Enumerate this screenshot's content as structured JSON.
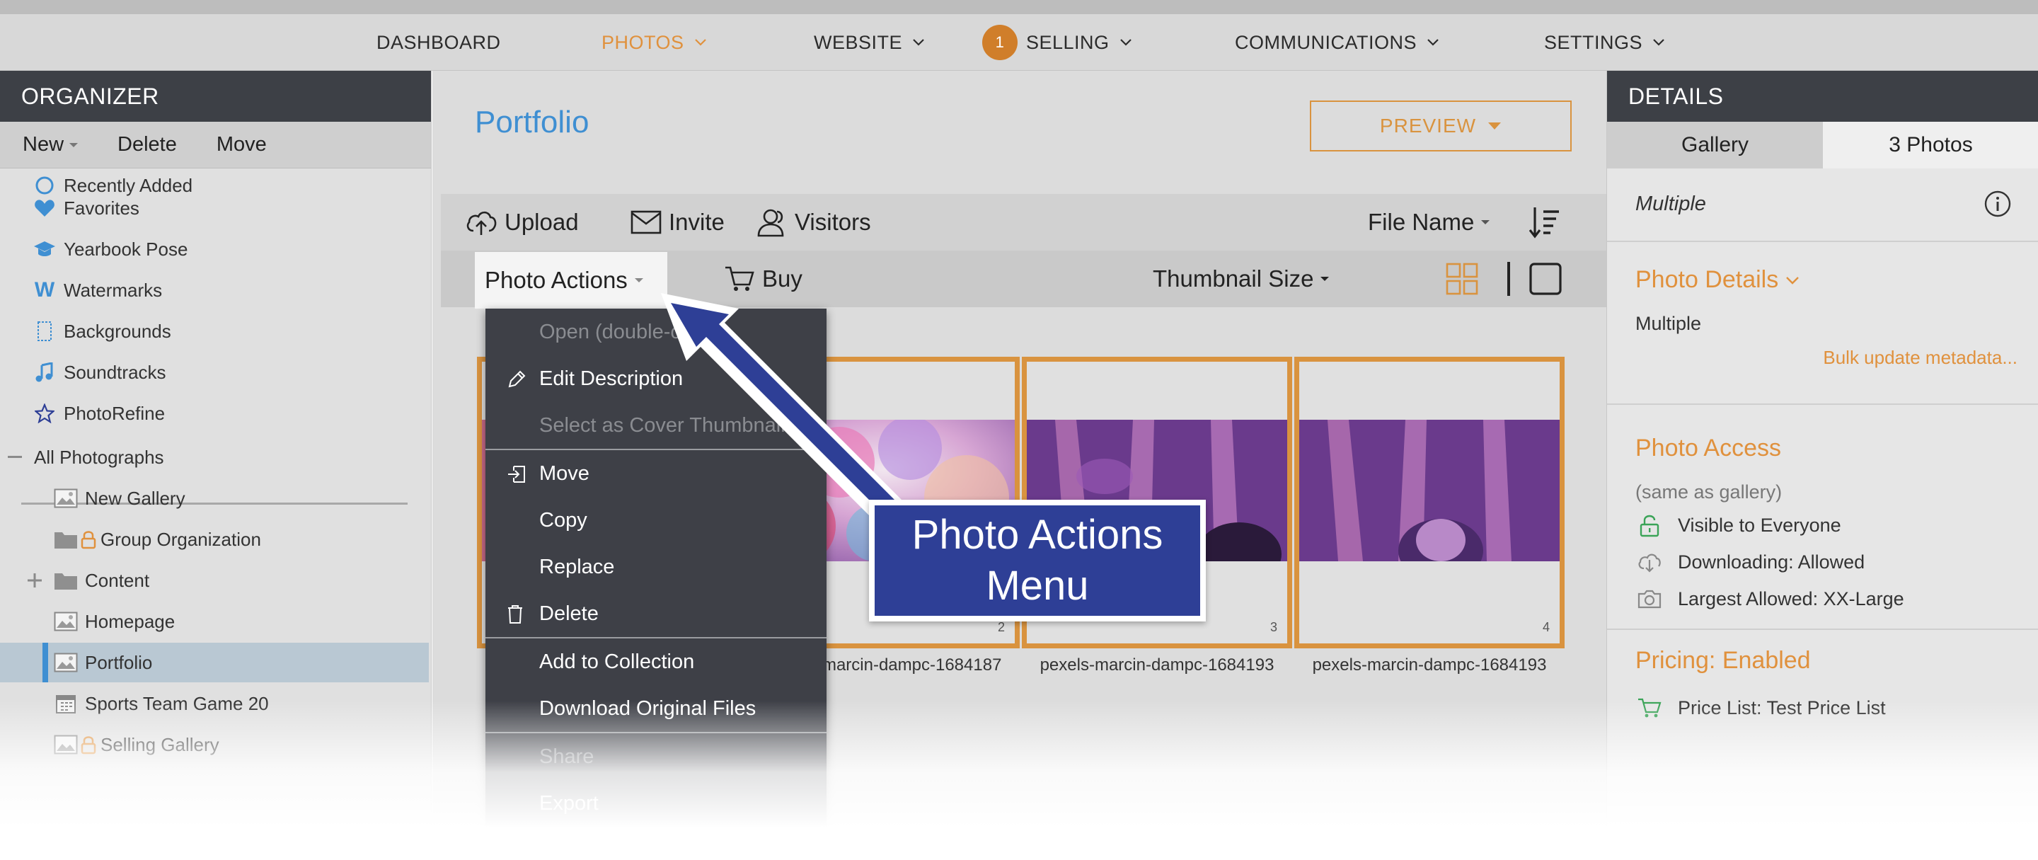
{
  "nav": {
    "items": [
      {
        "label": "DASHBOARD"
      },
      {
        "label": "PHOTOS"
      },
      {
        "label": "WEBSITE"
      },
      {
        "label": "SELLING",
        "badge": "1"
      },
      {
        "label": "COMMUNICATIONS"
      },
      {
        "label": "SETTINGS"
      }
    ]
  },
  "organizer": {
    "title": "ORGANIZER",
    "toolbar": {
      "new": "New",
      "delete": "Delete",
      "move": "Move"
    },
    "items": [
      {
        "label": "Recently Added",
        "icon": "clock-icon"
      },
      {
        "label": "Favorites",
        "icon": "heart-icon"
      },
      {
        "label": "Yearbook Pose",
        "icon": "graduation-cap-icon"
      },
      {
        "label": "Watermarks",
        "icon": "watermark-w-icon"
      },
      {
        "label": "Backgrounds",
        "icon": "backgrounds-icon"
      },
      {
        "label": "Soundtracks",
        "icon": "music-note-icon"
      },
      {
        "label": "PhotoRefine",
        "icon": "star-outline-icon"
      },
      {
        "label": "All Photographs",
        "icon": "collapse-minus-icon"
      },
      {
        "label": "New Gallery",
        "icon": "gallery-icon"
      },
      {
        "label": "Group Organization",
        "icon": "folder-locked-icon"
      },
      {
        "label": "Content",
        "icon": "folder-icon"
      },
      {
        "label": "Homepage",
        "icon": "gallery-icon"
      },
      {
        "label": "Portfolio",
        "icon": "gallery-icon"
      },
      {
        "label": "Sports Team Game 20",
        "icon": "calendar-icon"
      },
      {
        "label": "Selling Gallery",
        "icon": "gallery-locked-icon"
      }
    ]
  },
  "main": {
    "title": "Portfolio",
    "preview_label": "PREVIEW",
    "toolbar": {
      "upload": "Upload",
      "invite": "Invite",
      "visitors": "Visitors",
      "sort": "File Name",
      "photo_actions": "Photo Actions",
      "buy": "Buy",
      "thumbnail_size": "Thumbnail Size"
    },
    "photos": [
      {
        "name": "pexels-marcin-dampc-1684187",
        "index": "2"
      },
      {
        "name": "pexels-marcin-dampc-1684193",
        "index": "3"
      },
      {
        "name": "pexels-marcin-dampc-1684193",
        "index": "4"
      }
    ]
  },
  "menu": {
    "items": [
      {
        "label": "Open (double-click)",
        "disabled": true
      },
      {
        "label": "Edit Description",
        "icon": "pencil-icon"
      },
      {
        "label": "Select as Cover Thumbnail",
        "disabled": true
      },
      {
        "label": "Move",
        "icon": "move-in-icon"
      },
      {
        "label": "Copy"
      },
      {
        "label": "Replace"
      },
      {
        "label": "Delete",
        "icon": "trash-icon"
      },
      {
        "label": "Add to Collection"
      },
      {
        "label": "Download Original Files"
      },
      {
        "label": "Share",
        "disabled": true
      },
      {
        "label": "Export"
      }
    ]
  },
  "callout": {
    "line1": "Photo Actions",
    "line2": "Menu"
  },
  "details": {
    "title": "DETAILS",
    "tabs": [
      "Gallery",
      "3 Photos"
    ],
    "multiple": "Multiple",
    "photo_details": {
      "title": "Photo Details",
      "value": "Multiple",
      "link": "Bulk update metadata..."
    },
    "photo_access": {
      "title": "Photo Access",
      "subtitle": "(same as gallery)",
      "rows": [
        "Visible to Everyone",
        "Downloading: Allowed",
        "Largest Allowed: XX-Large"
      ]
    },
    "pricing": {
      "title": "Pricing: Enabled",
      "price_list": "Price List: Test Price List"
    }
  },
  "colors": {
    "accent": "#e0913d",
    "link": "#3f8fd2",
    "header": "#3d4046",
    "callout": "#2e3f96",
    "menu": "#3e4047"
  }
}
